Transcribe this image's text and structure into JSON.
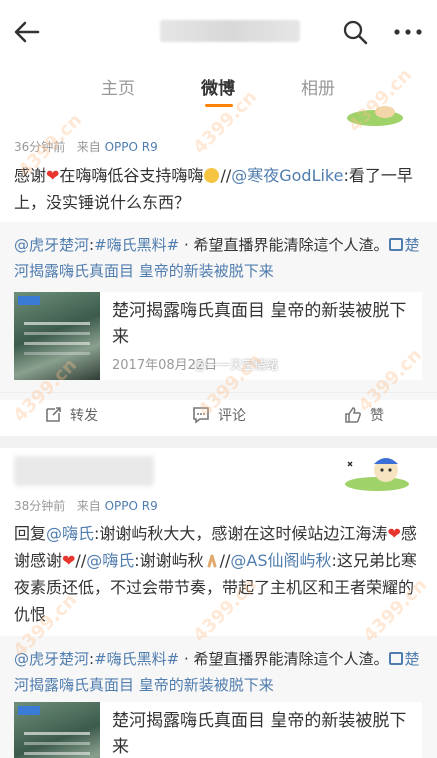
{
  "header": {
    "icons": {
      "back": "arrow-left-icon",
      "search": "search-icon",
      "more": "more-dots-icon"
    }
  },
  "tabs": [
    {
      "label": "主页"
    },
    {
      "label": "微博"
    },
    {
      "label": "相册"
    }
  ],
  "accent_color": "#ff8200",
  "link_color": "#507daf",
  "posts": [
    {
      "time": "36分钟前",
      "source_prefix": "来自",
      "source": "OPPO R9",
      "text": {
        "p1": "感谢",
        "p2": "在嗨嗨低谷支持嗨嗨",
        "p3": "//",
        "mention": "@寒夜GodLike",
        "p4": ":看了一早上，没实锤说什么东西？"
      },
      "repost": {
        "mention": "@虎牙楚河",
        "sep": ":",
        "tag": "#嗨氏黑料#",
        "text": " ·  希望直播界能清除這个人渣。",
        "link": "楚河揭露嗨氏真面目 皇帝的新装被脱下来"
      },
      "article": {
        "title": "楚河揭露嗨氏真面目 皇帝的新装被脱下来",
        "date": "2017年08月22日",
        "watermark": "@一一天空情绪"
      },
      "actions": {
        "repost": "转发",
        "comment": "评论",
        "like": "赞"
      }
    },
    {
      "time": "38分钟前",
      "source_prefix": "来自",
      "source": "OPPO R9",
      "text": {
        "a": "回复",
        "m1": "@嗨氏",
        "b": ":谢谢屿秋大大，感谢在这时候站边江海涛",
        "c": "感谢感谢",
        "d": "//",
        "m2": "@嗨氏",
        "e": ":谢谢屿秋",
        "f": "//",
        "m3": "@AS仙阁屿秋",
        "g": ":这兄弟比寒夜素质还低，不过会带节奏，带起了主机区和王者荣耀的仇恨"
      },
      "repost": {
        "mention": "@虎牙楚河",
        "sep": ":",
        "tag": "#嗨氏黑料#",
        "text": " ·  希望直播界能清除這个人渣。",
        "link": "楚河揭露嗨氏真面目 皇帝的新装被脱下来"
      },
      "article": {
        "title": "楚河揭露嗨氏真面目 皇帝的新装被脱下来"
      }
    }
  ],
  "watermark": "4399.cn"
}
